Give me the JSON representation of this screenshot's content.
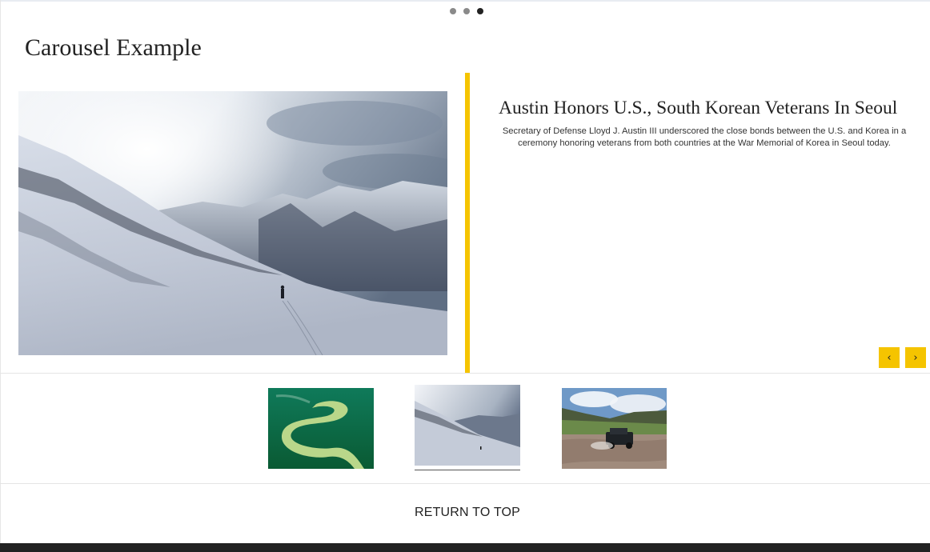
{
  "carousel": {
    "page_title": "Carousel Example",
    "dots": [
      {
        "label": "slide-1",
        "active": false
      },
      {
        "label": "slide-2",
        "active": false
      },
      {
        "label": "slide-3",
        "active": true
      }
    ],
    "active_slide": {
      "title": "Austin Honors U.S., South Korean Veterans In Seoul",
      "description": "Secretary of Defense Lloyd J. Austin III underscored the close bonds between the U.S. and Korea in a ceremony honoring veterans from both countries at the War Memorial of Korea in Seoul today."
    },
    "controls": {
      "prev_icon": "‹",
      "next_icon": "›"
    },
    "thumbnails": [
      {
        "name": "winding-river-thumbnail",
        "selected": false
      },
      {
        "name": "snowy-mountain-thumbnail",
        "selected": true
      },
      {
        "name": "jeep-river-crossing-thumbnail",
        "selected": false
      }
    ],
    "accent_color": "#f5c400"
  },
  "footer": {
    "return_to_top": "RETURN TO TOP"
  }
}
